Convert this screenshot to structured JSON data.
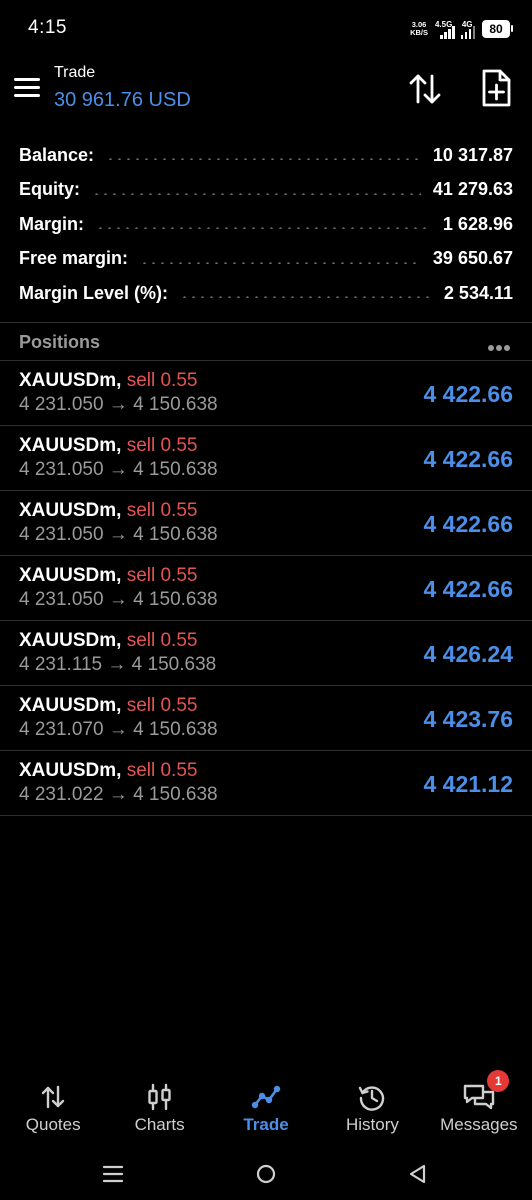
{
  "status_bar": {
    "time": "4:15",
    "speed_value": "3.06",
    "speed_unit": "KB/S",
    "net1": "4.5G",
    "net2": "4G",
    "battery": "80"
  },
  "header": {
    "title": "Trade",
    "balance": "30 961.76 USD"
  },
  "summary": [
    {
      "label": "Balance:",
      "value": "10 317.87"
    },
    {
      "label": "Equity:",
      "value": "41 279.63"
    },
    {
      "label": "Margin:",
      "value": "1 628.96"
    },
    {
      "label": "Free margin:",
      "value": "39 650.67"
    },
    {
      "label": "Margin Level (%):",
      "value": "2 534.11"
    }
  ],
  "positions": {
    "title": "Positions",
    "items": [
      {
        "symbol": "XAUUSDm,",
        "side": "sell 0.55",
        "prices": "4 231.050 → 4 150.638",
        "profit": "4 422.66"
      },
      {
        "symbol": "XAUUSDm,",
        "side": "sell 0.55",
        "prices": "4 231.050 → 4 150.638",
        "profit": "4 422.66"
      },
      {
        "symbol": "XAUUSDm,",
        "side": "sell 0.55",
        "prices": "4 231.050 → 4 150.638",
        "profit": "4 422.66"
      },
      {
        "symbol": "XAUUSDm,",
        "side": "sell 0.55",
        "prices": "4 231.050 → 4 150.638",
        "profit": "4 422.66"
      },
      {
        "symbol": "XAUUSDm,",
        "side": "sell 0.55",
        "prices": "4 231.115 → 4 150.638",
        "profit": "4 426.24"
      },
      {
        "symbol": "XAUUSDm,",
        "side": "sell 0.55",
        "prices": "4 231.070 → 4 150.638",
        "profit": "4 423.76"
      },
      {
        "symbol": "XAUUSDm,",
        "side": "sell 0.55",
        "prices": "4 231.022 → 4 150.638",
        "profit": "4 421.12"
      }
    ]
  },
  "bottom_nav": {
    "items": [
      {
        "label": "Quotes",
        "icon": "quotes-icon"
      },
      {
        "label": "Charts",
        "icon": "charts-icon"
      },
      {
        "label": "Trade",
        "icon": "trade-icon",
        "active": true
      },
      {
        "label": "History",
        "icon": "history-icon"
      },
      {
        "label": "Messages",
        "icon": "messages-icon",
        "badge": "1"
      }
    ]
  },
  "colors": {
    "accent": "#4b8fe8",
    "sell": "#e35454",
    "muted": "#9a9a9a",
    "background": "#000000",
    "badge": "#e53935"
  }
}
